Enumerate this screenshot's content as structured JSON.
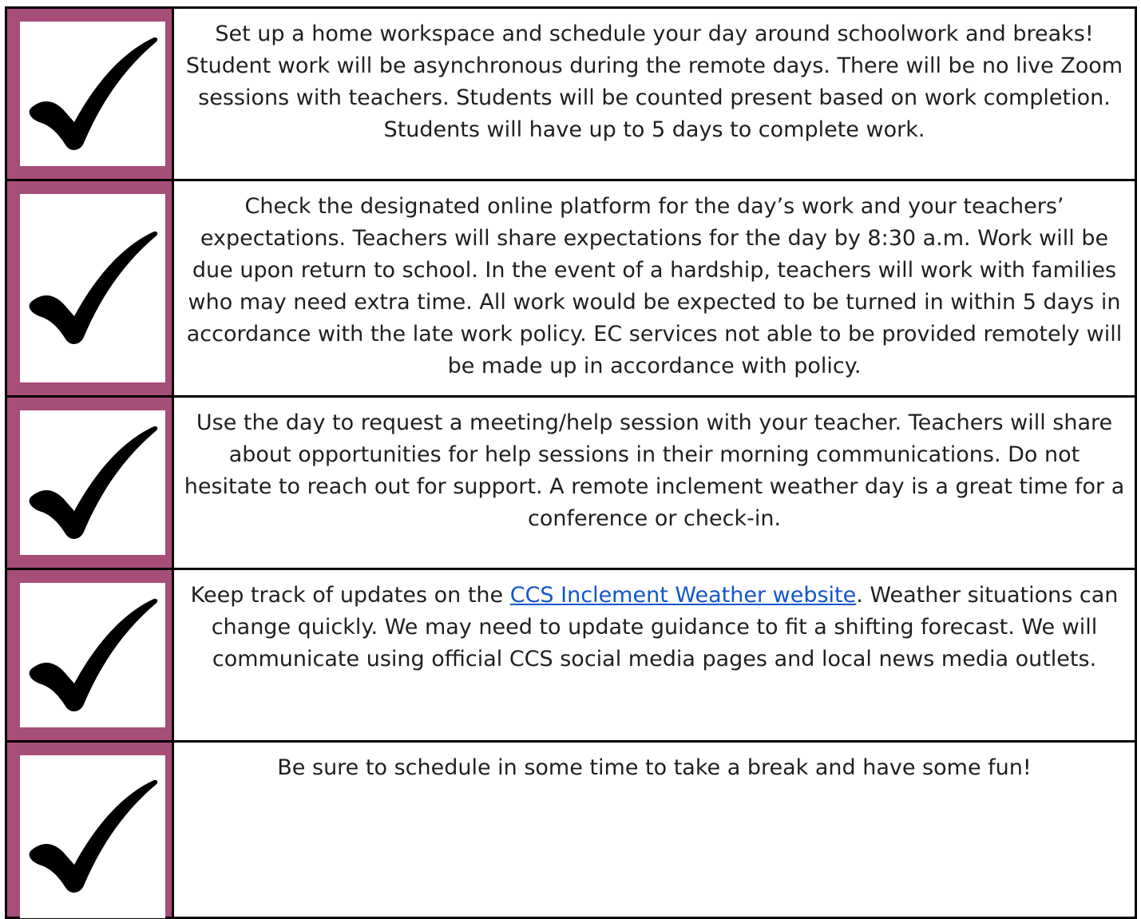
{
  "colors": {
    "accent": "#a64d79",
    "text": "#1f1f1f",
    "link": "#1155cc",
    "border": "#000000"
  },
  "icon": "checkmark-icon",
  "rows": [
    {
      "text": "Set up a home workspace and schedule your day around schoolwork and breaks! Student work will be asynchronous during the remote days.  There will be no live Zoom sessions with teachers. Students will be counted present based on work completion.  Students will have up to 5 days to complete work."
    },
    {
      "text": "Check the designated online platform for the day’s work and your teachers’ expectations. Teachers will share expectations for the day by 8:30 a.m. Work will be due upon return to school.  In the event of a hardship, teachers will work with families who may need extra time. All work would be expected to be turned in within 5 days in accordance with the late work policy. EC services not able to be provided remotely will be made up in accordance with policy."
    },
    {
      "text": "Use the day to request a meeting/help session with your teacher. Teachers will share about opportunities for help sessions in their morning communications. Do not hesitate to reach out for support.  A remote inclement weather day is a great time for a conference or check-in."
    },
    {
      "text_before": "Keep track of updates on the ",
      "link_text": "CCS Inclement Weather website",
      "text_after": ".  Weather situations can change quickly.  We may need to update guidance to fit a shifting forecast. We will communicate using official CCS social media pages and local news media outlets."
    },
    {
      "text": "Be sure to schedule in some time to take a break and have some fun!"
    }
  ]
}
